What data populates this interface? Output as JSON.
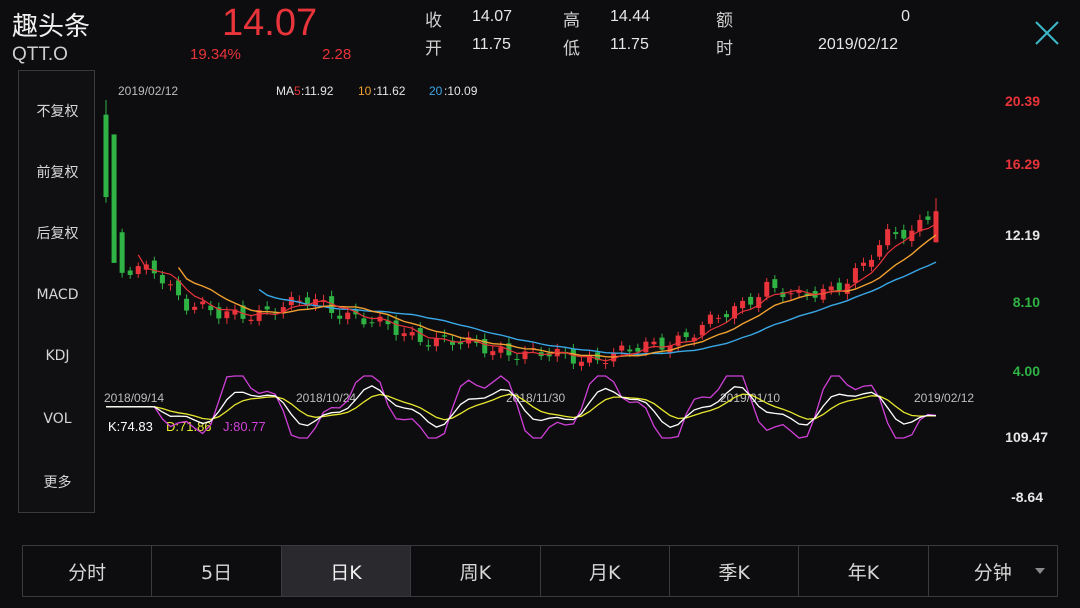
{
  "header": {
    "name": "趣头条",
    "code": "QTT.O",
    "price": "14.07",
    "change_pct": "19.34%",
    "change": "2.28",
    "quote": [
      {
        "label": "收",
        "value": "14.07"
      },
      {
        "label": "高",
        "value": "14.44"
      },
      {
        "label": "额",
        "value": "0"
      },
      {
        "label": "开",
        "value": "11.75"
      },
      {
        "label": "低",
        "value": "11.75"
      },
      {
        "label": "时",
        "value": "2019/02/12"
      }
    ]
  },
  "left_menu": [
    {
      "label": "不复权",
      "active": true
    },
    {
      "label": "前复权",
      "active": false
    },
    {
      "label": "后复权",
      "active": false
    },
    {
      "label": "MACD",
      "active": false
    },
    {
      "label": "KDJ",
      "active": true
    },
    {
      "label": "VOL",
      "active": false
    },
    {
      "label": "更多",
      "active": false
    }
  ],
  "chart": {
    "date": "2019/02/12",
    "ma_prefix": "MA",
    "ma": [
      {
        "label": "5",
        "value": "11.92",
        "color": "#e8343a"
      },
      {
        "label": "10",
        "value": "11.62",
        "color": "#f0a030"
      },
      {
        "label": "20",
        "value": "10.09",
        "color": "#3aa7e6"
      }
    ],
    "y_ticks": [
      {
        "label": "20.39",
        "color": "#e8343a"
      },
      {
        "label": "16.29",
        "color": "#e8343a"
      },
      {
        "label": "12.19",
        "color": "#e6e6e6"
      },
      {
        "label": "8.10",
        "color": "#2fb344"
      },
      {
        "label": "4.00",
        "color": "#2fb344"
      }
    ],
    "x_ticks": [
      "2018/09/14",
      "2018/10/24",
      "2018/11/30",
      "2019/01/10",
      "2019/02/12"
    ],
    "kdj": {
      "k_label": "K:74.83",
      "d_label": "D:71.86",
      "j_label": "J:80.77",
      "k_color": "#ffffff",
      "d_color": "#e8e830",
      "j_color": "#d040d8",
      "max": "109.47",
      "min": "-8.64"
    }
  },
  "tabs": [
    {
      "label": "分时",
      "active": false
    },
    {
      "label": "5日",
      "active": false
    },
    {
      "label": "日K",
      "active": true
    },
    {
      "label": "周K",
      "active": false
    },
    {
      "label": "月K",
      "active": false
    },
    {
      "label": "季K",
      "active": false
    },
    {
      "label": "年K",
      "active": false
    },
    {
      "label": "分钟",
      "active": false
    }
  ]
}
